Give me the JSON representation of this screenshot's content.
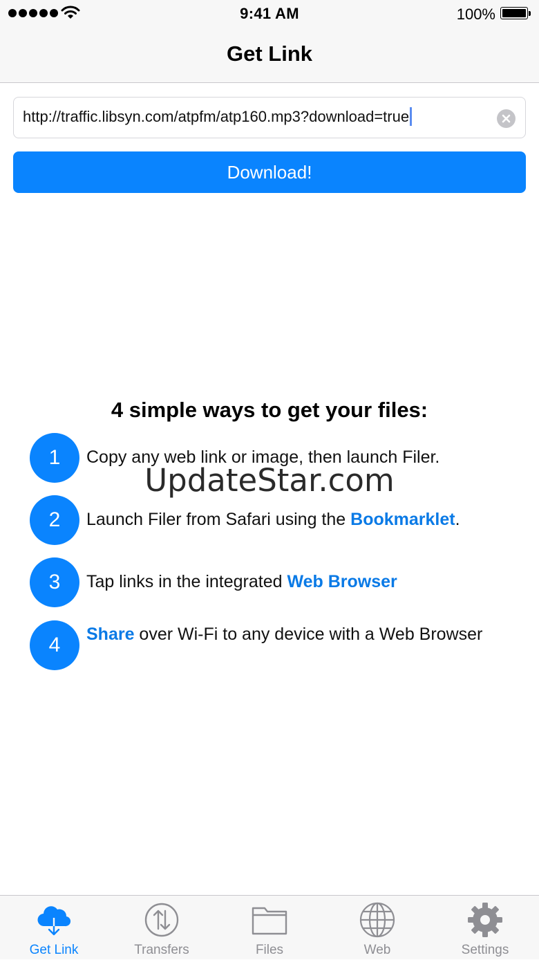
{
  "status": {
    "time": "9:41 AM",
    "battery": "100%"
  },
  "nav": {
    "title": "Get Link"
  },
  "url_field": {
    "value": "http://traffic.libsyn.com/atpfm/atp160.mp3?download=true"
  },
  "download_button": {
    "label": "Download!"
  },
  "ways": {
    "heading": "4 simple ways to get your files:",
    "steps": [
      {
        "num": "1",
        "text": "Copy any web link or image, then launch Filer."
      },
      {
        "num": "2",
        "prefix": "Launch Filer from Safari using the ",
        "link": "Bookmarklet",
        "suffix": "."
      },
      {
        "num": "3",
        "prefix": "Tap links in the integrated ",
        "link": "Web Browser"
      },
      {
        "num": "4",
        "link": "Share",
        "suffix": " over Wi-Fi to any device with a Web Browser"
      }
    ]
  },
  "watermark": "UpdateStar.com",
  "tabs": [
    {
      "label": "Get Link",
      "icon": "cloud-download-icon",
      "active": true
    },
    {
      "label": "Transfers",
      "icon": "transfers-icon"
    },
    {
      "label": "Files",
      "icon": "folder-icon"
    },
    {
      "label": "Web",
      "icon": "globe-icon"
    },
    {
      "label": "Settings",
      "icon": "gear-icon"
    }
  ],
  "colors": {
    "accent": "#0a84fe",
    "link": "#0a7ae6",
    "inactive": "#8e8e93"
  }
}
